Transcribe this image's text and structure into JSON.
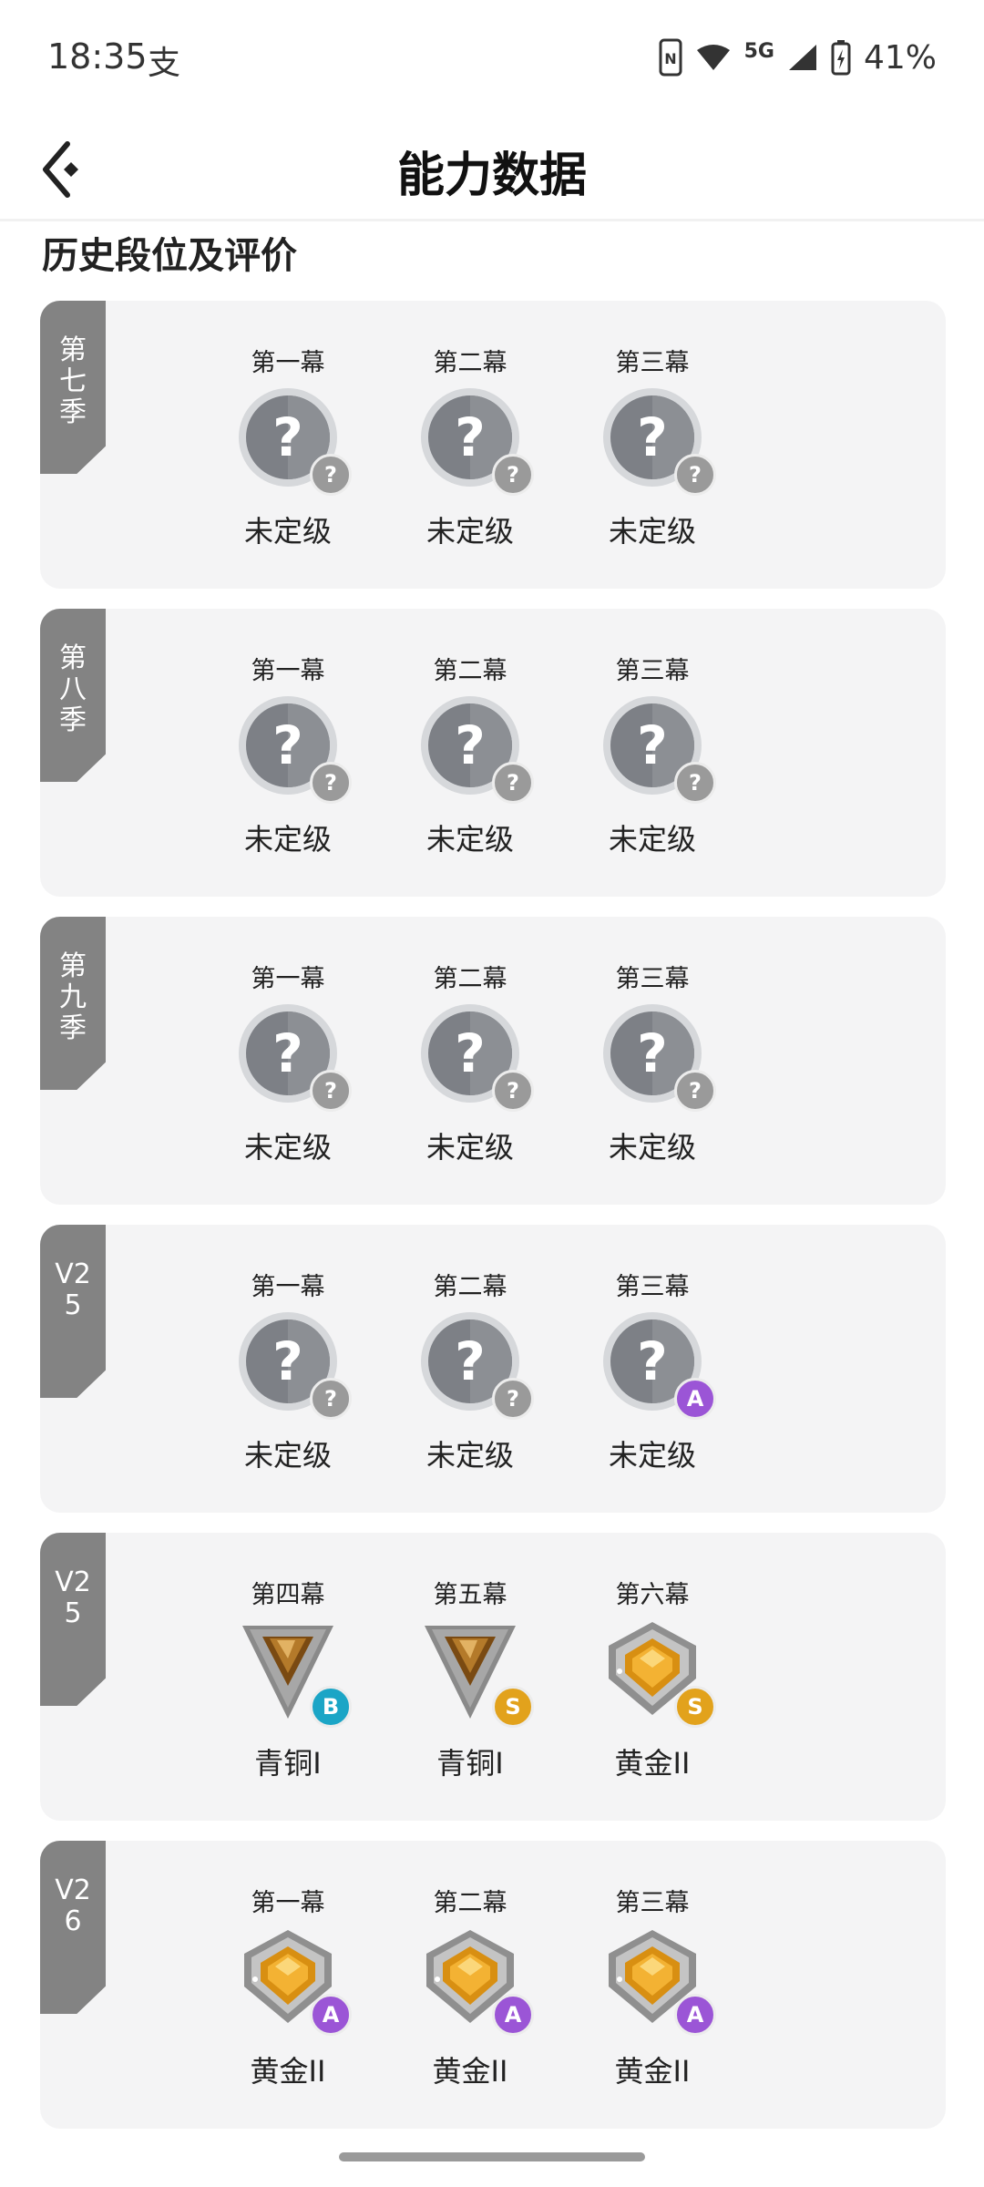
{
  "status_bar": {
    "time": "18:35",
    "left_icon": "支",
    "network": "5G",
    "battery_text": "41%"
  },
  "header": {
    "title": "能力数据"
  },
  "section_title": "历史段位及评价",
  "colors": {
    "tab_bg": "#838383",
    "card_bg": "#f4f4f5",
    "grade_question": "#9a9a9a",
    "grade_A": "#9b55d6",
    "grade_B": "#1ba5c6",
    "grade_S": "#e2a21c"
  },
  "seasons": [
    {
      "tab_label": "第七季",
      "acts": [
        {
          "title": "第一幕",
          "rank_icon": "unranked-icon",
          "rank_label": "未定级",
          "grade": "?"
        },
        {
          "title": "第二幕",
          "rank_icon": "unranked-icon",
          "rank_label": "未定级",
          "grade": "?"
        },
        {
          "title": "第三幕",
          "rank_icon": "unranked-icon",
          "rank_label": "未定级",
          "grade": "?"
        }
      ]
    },
    {
      "tab_label": "第八季",
      "acts": [
        {
          "title": "第一幕",
          "rank_icon": "unranked-icon",
          "rank_label": "未定级",
          "grade": "?"
        },
        {
          "title": "第二幕",
          "rank_icon": "unranked-icon",
          "rank_label": "未定级",
          "grade": "?"
        },
        {
          "title": "第三幕",
          "rank_icon": "unranked-icon",
          "rank_label": "未定级",
          "grade": "?"
        }
      ]
    },
    {
      "tab_label": "第九季",
      "acts": [
        {
          "title": "第一幕",
          "rank_icon": "unranked-icon",
          "rank_label": "未定级",
          "grade": "?"
        },
        {
          "title": "第二幕",
          "rank_icon": "unranked-icon",
          "rank_label": "未定级",
          "grade": "?"
        },
        {
          "title": "第三幕",
          "rank_icon": "unranked-icon",
          "rank_label": "未定级",
          "grade": "?"
        }
      ]
    },
    {
      "tab_label": "V25",
      "acts": [
        {
          "title": "第一幕",
          "rank_icon": "unranked-icon",
          "rank_label": "未定级",
          "grade": "?"
        },
        {
          "title": "第二幕",
          "rank_icon": "unranked-icon",
          "rank_label": "未定级",
          "grade": "?"
        },
        {
          "title": "第三幕",
          "rank_icon": "unranked-icon",
          "rank_label": "未定级",
          "grade": "A"
        }
      ]
    },
    {
      "tab_label": "V25",
      "acts": [
        {
          "title": "第四幕",
          "rank_icon": "bronze-rank-icon",
          "rank_label": "青铜I",
          "grade": "B"
        },
        {
          "title": "第五幕",
          "rank_icon": "bronze-rank-icon",
          "rank_label": "青铜I",
          "grade": "S"
        },
        {
          "title": "第六幕",
          "rank_icon": "gold-rank-icon",
          "rank_label": "黄金II",
          "grade": "S"
        }
      ]
    },
    {
      "tab_label": "V26",
      "acts": [
        {
          "title": "第一幕",
          "rank_icon": "gold-rank-icon",
          "rank_label": "黄金II",
          "grade": "A"
        },
        {
          "title": "第二幕",
          "rank_icon": "gold-rank-icon",
          "rank_label": "黄金II",
          "grade": "A"
        },
        {
          "title": "第三幕",
          "rank_icon": "gold-rank-icon",
          "rank_label": "黄金II",
          "grade": "A"
        }
      ]
    }
  ]
}
